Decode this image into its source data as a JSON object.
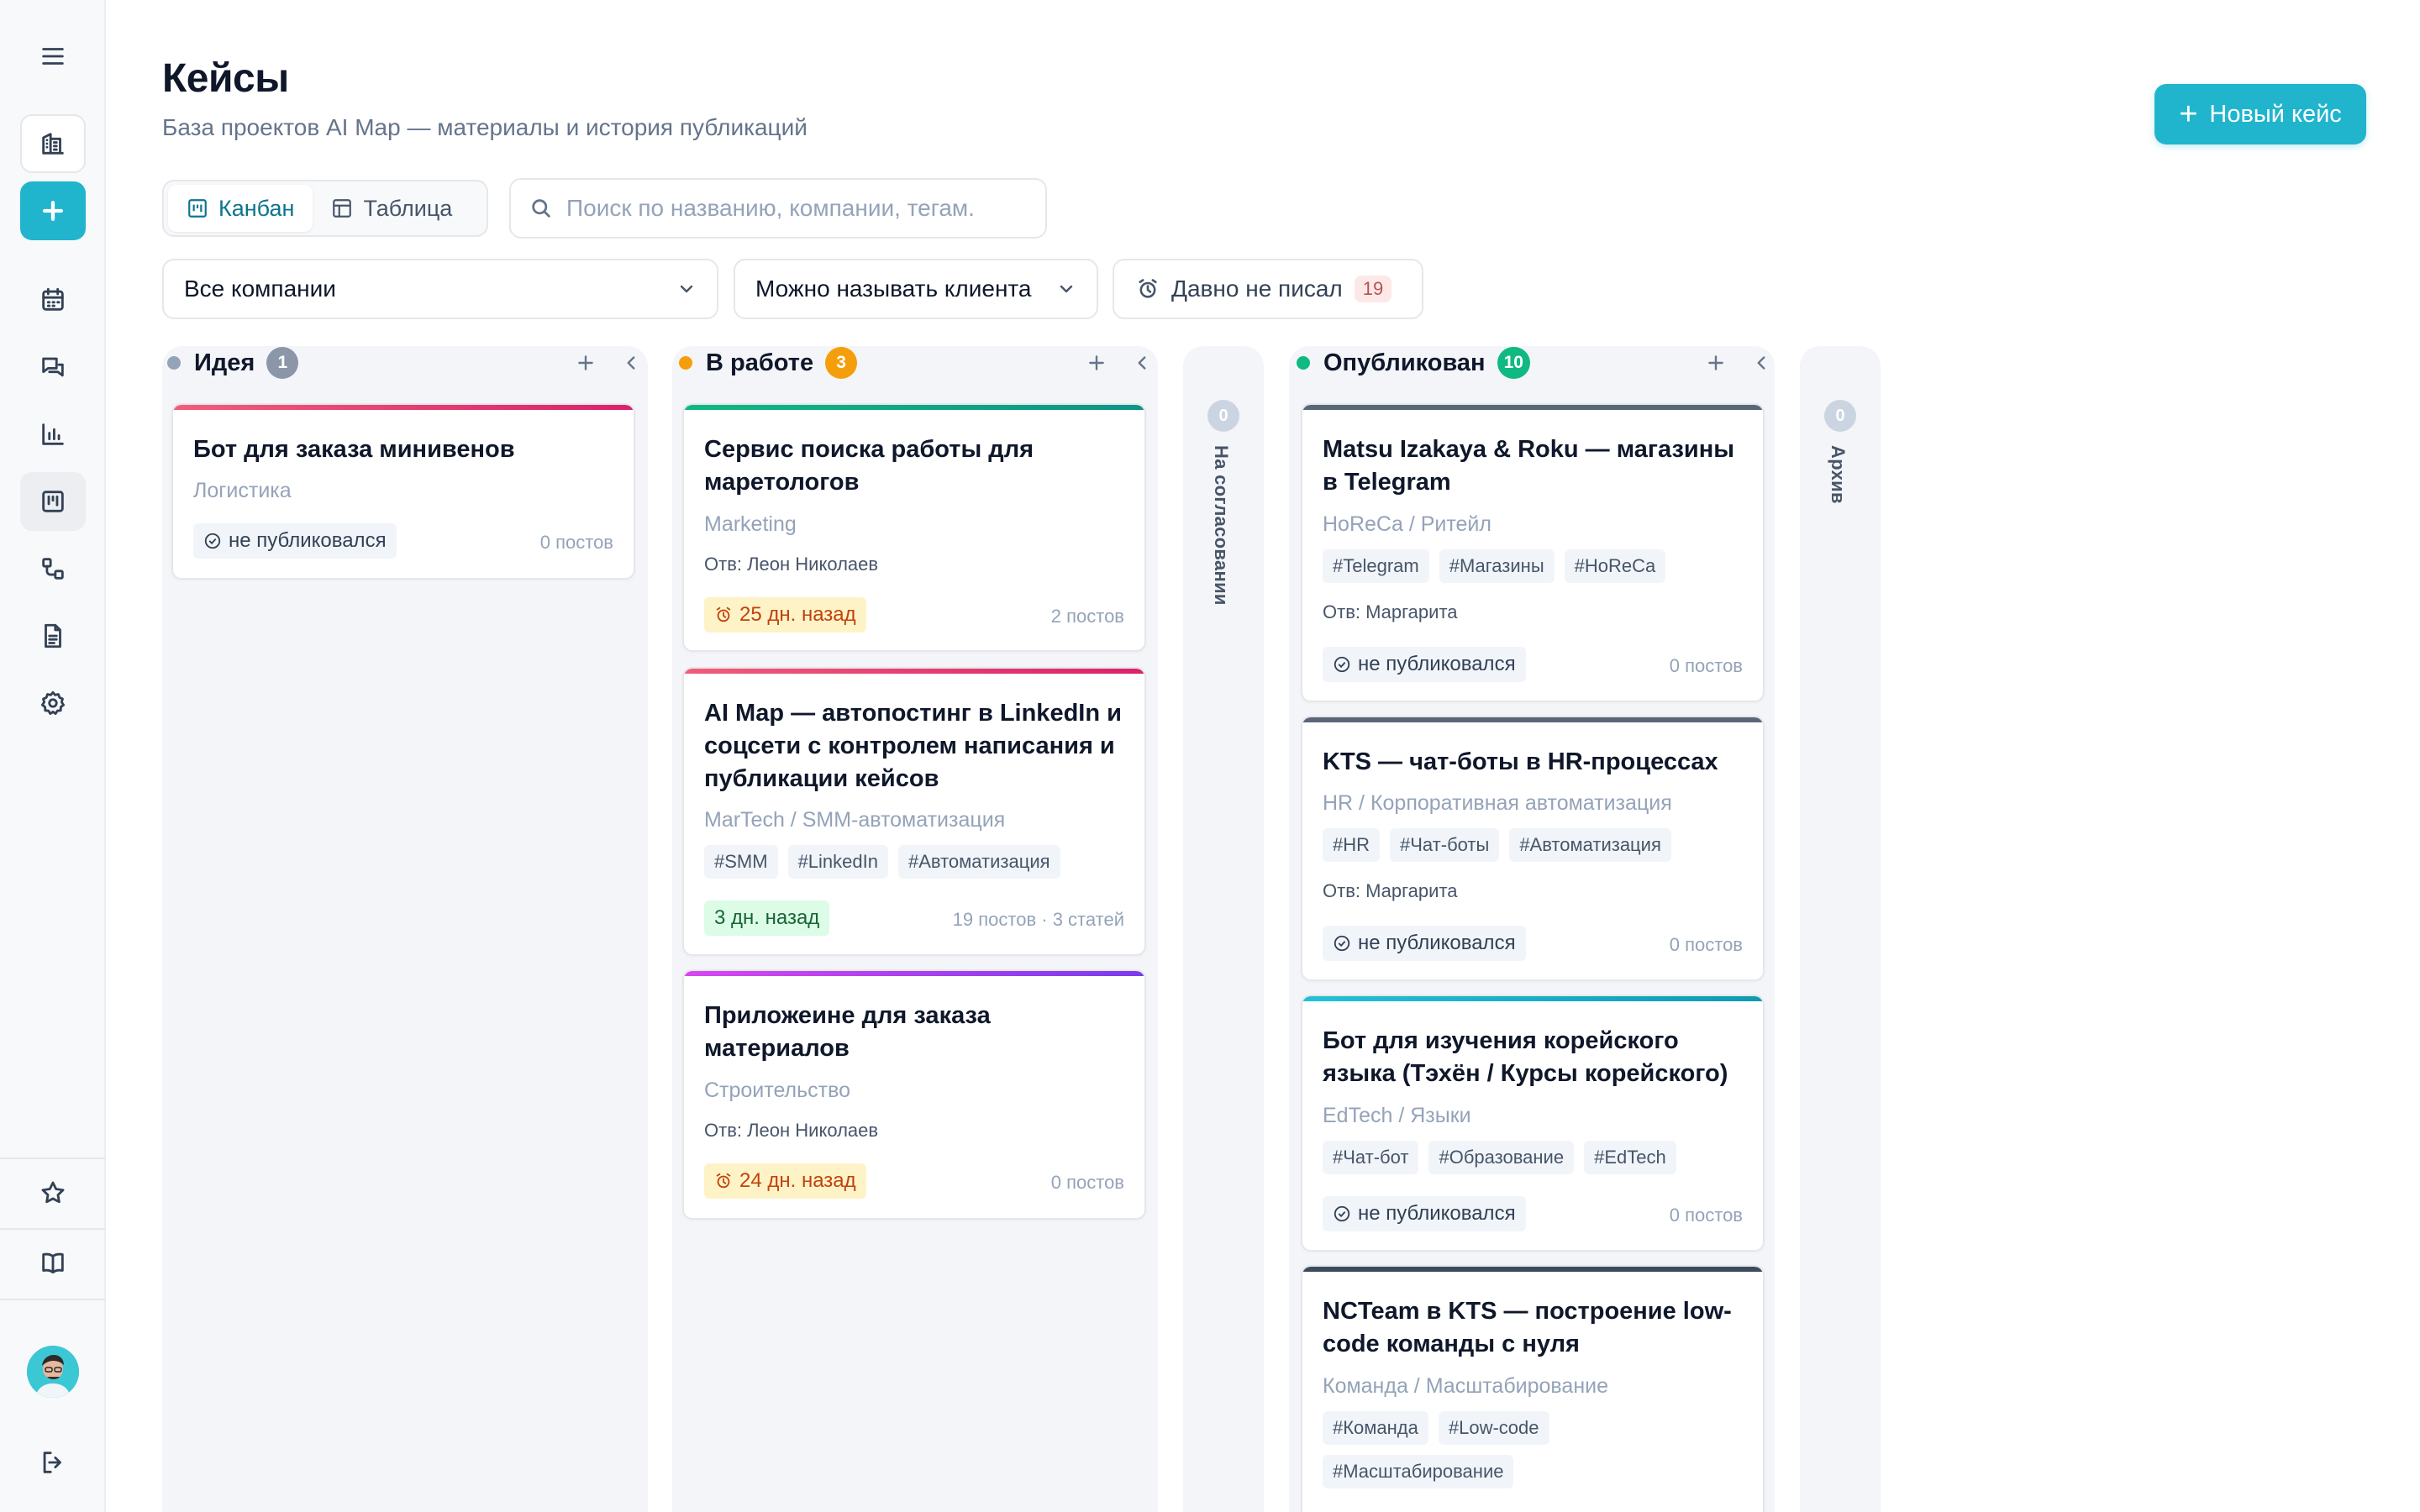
{
  "header": {
    "title": "Кейсы",
    "subtitle": "База проектов AI Map — материалы и история публикаций",
    "new_case_label": "Новый кейс"
  },
  "view": {
    "tabs": [
      {
        "label": "Канбан",
        "active": true
      },
      {
        "label": "Таблица",
        "active": false
      }
    ]
  },
  "search": {
    "placeholder": "Поиск по названию, компании, тегам.",
    "value": ""
  },
  "filters": {
    "company": "Все компании",
    "client_naming": "Можно называть клиента",
    "stale_label": "Давно не писал",
    "stale_count": "19"
  },
  "sidebar": {
    "icons": [
      "menu-icon",
      "building-icon",
      "plus-icon",
      "calendar-icon",
      "chat-icon",
      "chart-icon",
      "kanban-icon",
      "workflow-icon",
      "document-icon",
      "gear-icon",
      "star-icon",
      "book-icon",
      "avatar",
      "logout-icon"
    ]
  },
  "columns": [
    {
      "title": "Идея",
      "count": "1",
      "color": "#94a3b8",
      "cards": [
        {
          "title": "Бот для заказа минивенов",
          "category": "Логистика",
          "status": "не публиковался",
          "posts": "0 постов",
          "bar": "#e8436e"
        }
      ]
    },
    {
      "title": "В работе",
      "count": "3",
      "color": "#f59e0b",
      "cards": [
        {
          "title": "Сервис поиска работы для маретологов",
          "category": "Marketing",
          "owner": "Отв: Леон Николаев",
          "status": "25 дн. назад",
          "posts": "2 постов",
          "bar": "#10b981"
        },
        {
          "title": "AI Map — автопостинг в LinkedIn и соцсети с контролем написания и публикации кейсов",
          "category": "MarTech / SMM-автоматизация",
          "tags": [
            "#SMM",
            "#LinkedIn",
            "#Автоматизация"
          ],
          "status": "3 дн. назад",
          "posts": "19 постов · 3 статей",
          "bar": "#e8436e"
        },
        {
          "title": "Приложеине для заказа материалов",
          "category": "Строительство",
          "owner": "Отв: Леон Николаев",
          "status": "24 дн. назад",
          "posts": "0 постов",
          "bar": "#a855f7"
        }
      ]
    },
    {
      "title": "На согласовании",
      "count": "0",
      "collapsed": true
    },
    {
      "title": "Опубликован",
      "count": "10",
      "color": "#10b981",
      "cards": [
        {
          "title": "Matsu Izakaya & Roku — магазины в Telegram",
          "category": "HoReCa / Ритейл",
          "tags": [
            "#Telegram",
            "#Магазины",
            "#HoReCa"
          ],
          "owner": "Отв: Маргарита",
          "status": "не публиковался",
          "posts": "0 постов",
          "bar": "#64748b"
        },
        {
          "title": "KTS — чат-боты в HR-процессах",
          "category": "HR / Корпоративная автоматизация",
          "tags": [
            "#HR",
            "#Чат-боты",
            "#Автоматизация"
          ],
          "owner": "Отв: Маргарита",
          "status": "не публиковался",
          "posts": "0 постов",
          "bar": "#64748b"
        },
        {
          "title": "Бот для изучения корейского языка (Тэхён / Курсы корейского)",
          "category": "EdTech / Языки",
          "tags": [
            "#Чат-бот",
            "#Образование",
            "#EdTech"
          ],
          "status": "не публиковался",
          "posts": "0 постов",
          "bar": "#20b5cd"
        },
        {
          "title": "NCTeam в KTS — построение low-code команды с нуля",
          "category": "Команда / Масштабирование",
          "tags": [
            "#Команда",
            "#Low-code",
            "#Масштабирование"
          ],
          "bar": "#475569"
        }
      ]
    },
    {
      "title": "Архив",
      "count": "0",
      "collapsed": true
    }
  ]
}
